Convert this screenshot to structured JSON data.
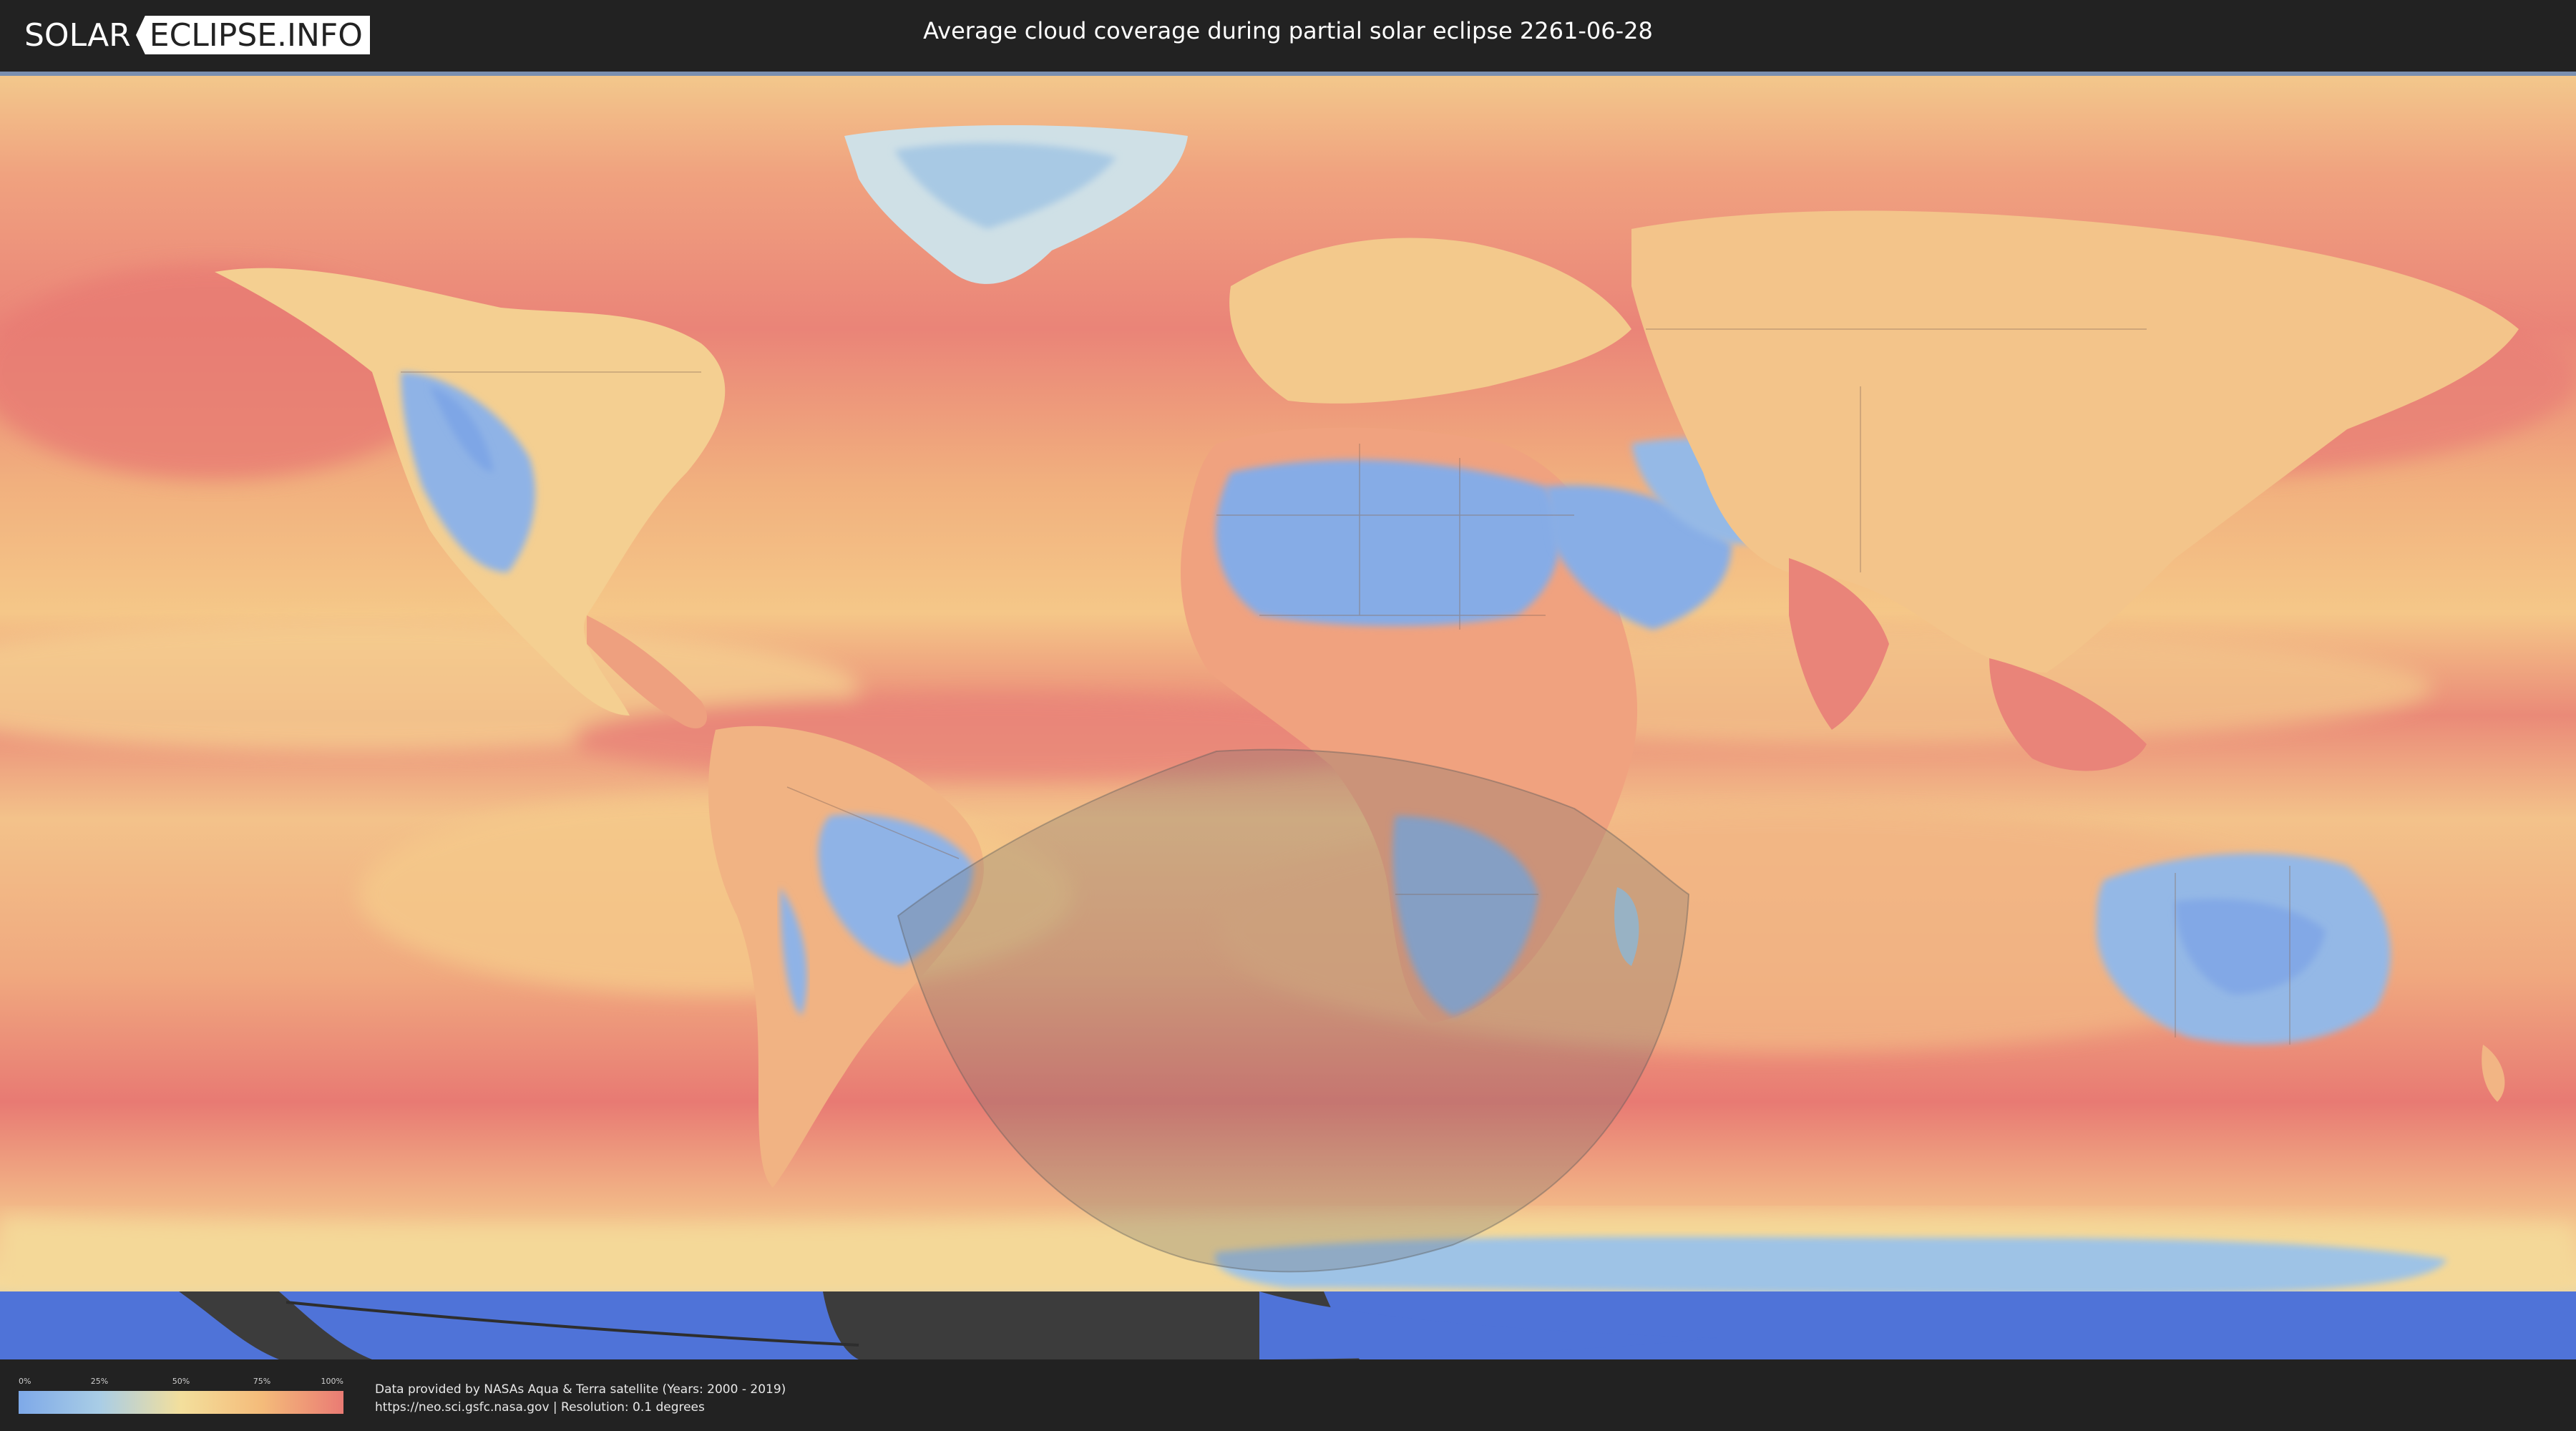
{
  "header": {
    "logo_solar": "SOLAR",
    "logo_eclipse": "ECLIPSE.INFO",
    "title": "Average cloud coverage during partial solar eclipse 2261-06-28"
  },
  "legend": {
    "ticks": [
      "0%",
      "25%",
      "50%",
      "75%",
      "100%"
    ],
    "colors": [
      "#7ea9e8",
      "#a9cde6",
      "#f3df9c",
      "#f4bb7a",
      "#ea7b74"
    ]
  },
  "credits": {
    "line1": "Data provided by NASAs Aqua & Terra satellite (Years: 2000 - 2019)",
    "line2": "https://neo.sci.gsfc.nasa.gov | Resolution: 0.1 degrees"
  },
  "map": {
    "ocean_color": "#ef8f7a",
    "eclipse_shadow_color": "#6b6b6b",
    "antarctic_color": "#4f73d8"
  }
}
